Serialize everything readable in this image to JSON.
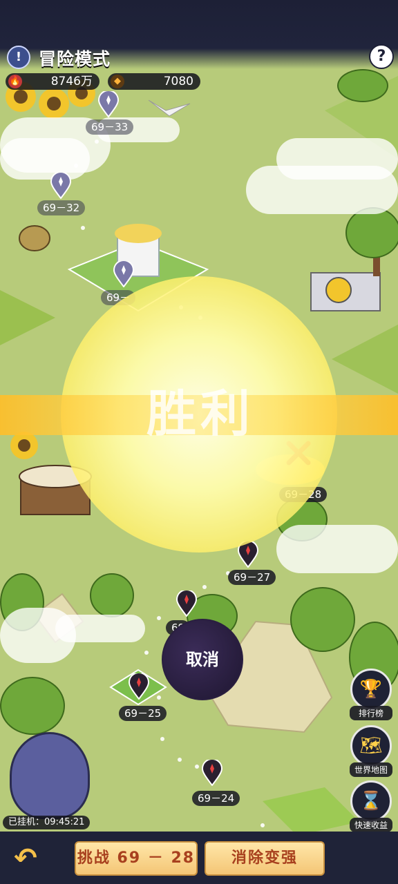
{
  "header": {
    "title": "冒险模式",
    "info_icon": "!",
    "help_icon": "?"
  },
  "resources": [
    {
      "icon": "fire-icon",
      "value": "8746万"
    },
    {
      "icon": "diamond-icon",
      "value": "7080"
    }
  ],
  "stages": [
    {
      "label": "69－33"
    },
    {
      "label": "69－32"
    },
    {
      "label": "69－"
    },
    {
      "label": "69－28"
    },
    {
      "label": "69－27"
    },
    {
      "label": "69"
    },
    {
      "label": "69－25"
    },
    {
      "label": "69－24"
    }
  ],
  "overlay": {
    "victory_text": "胜利",
    "cancel_label": "取消"
  },
  "side_menu": [
    {
      "label": "排行榜",
      "icon": "trophy-icon"
    },
    {
      "label": "世界地图",
      "icon": "map-icon"
    },
    {
      "label": "快速收益",
      "icon": "hourglass-icon"
    }
  ],
  "afk": {
    "time_text": "已挂机：09:45:21"
  },
  "bottom": {
    "challenge_label": "挑战 69 － 28",
    "upgrade_label": "消除变强"
  }
}
